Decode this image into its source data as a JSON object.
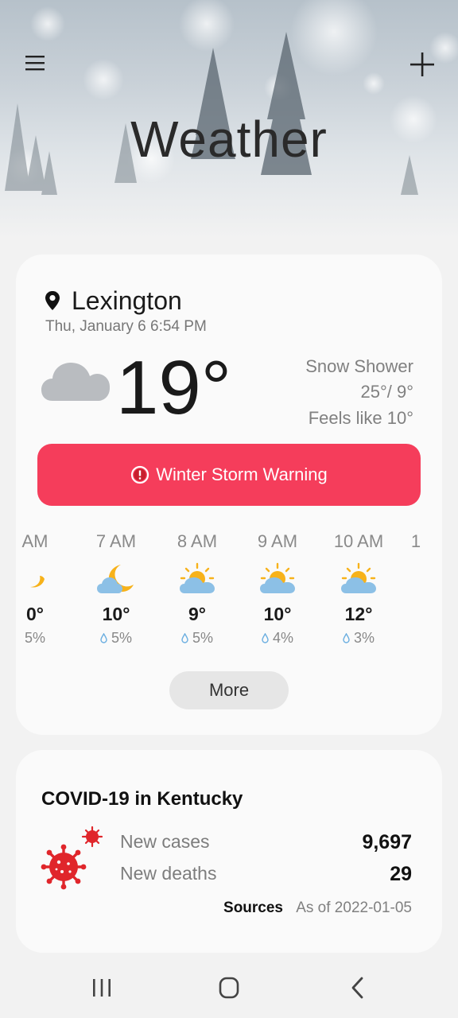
{
  "header": {
    "title": "Weather",
    "menu_icon": "hamburger-icon",
    "add_icon": "plus-icon"
  },
  "current": {
    "location": "Lexington",
    "datetime": "Thu, January 6 6:54 PM",
    "temperature": "19°",
    "condition": "Snow Shower",
    "hi_lo": "25°/ 9°",
    "feels_like": "Feels like 10°",
    "condition_icon": "cloud-icon"
  },
  "alert": {
    "label": "Winter Storm Warning",
    "color": "#f53d5b"
  },
  "hourly": [
    {
      "time": "AM",
      "temp": "0°",
      "precip": "5%",
      "icon": "moon-partial-icon"
    },
    {
      "time": "7 AM",
      "temp": "10°",
      "precip": "5%",
      "icon": "moon-cloud-icon"
    },
    {
      "time": "8 AM",
      "temp": "9°",
      "precip": "5%",
      "icon": "sun-cloud-icon"
    },
    {
      "time": "9 AM",
      "temp": "10°",
      "precip": "4%",
      "icon": "sun-cloud-icon"
    },
    {
      "time": "10 AM",
      "temp": "12°",
      "precip": "3%",
      "icon": "sun-cloud-icon"
    },
    {
      "time": "1",
      "temp": "",
      "precip": "",
      "icon": ""
    }
  ],
  "more_label": "More",
  "covid": {
    "title": "COVID-19 in Kentucky",
    "new_cases_label": "New cases",
    "new_cases_value": "9,697",
    "new_deaths_label": "New deaths",
    "new_deaths_value": "29",
    "sources_label": "Sources",
    "as_of": "As of 2022-01-05",
    "icon": "virus-icon",
    "color": "#e0262b"
  },
  "navbar": {
    "recents_icon": "recents-icon",
    "home_icon": "home-icon",
    "back_icon": "back-icon"
  }
}
